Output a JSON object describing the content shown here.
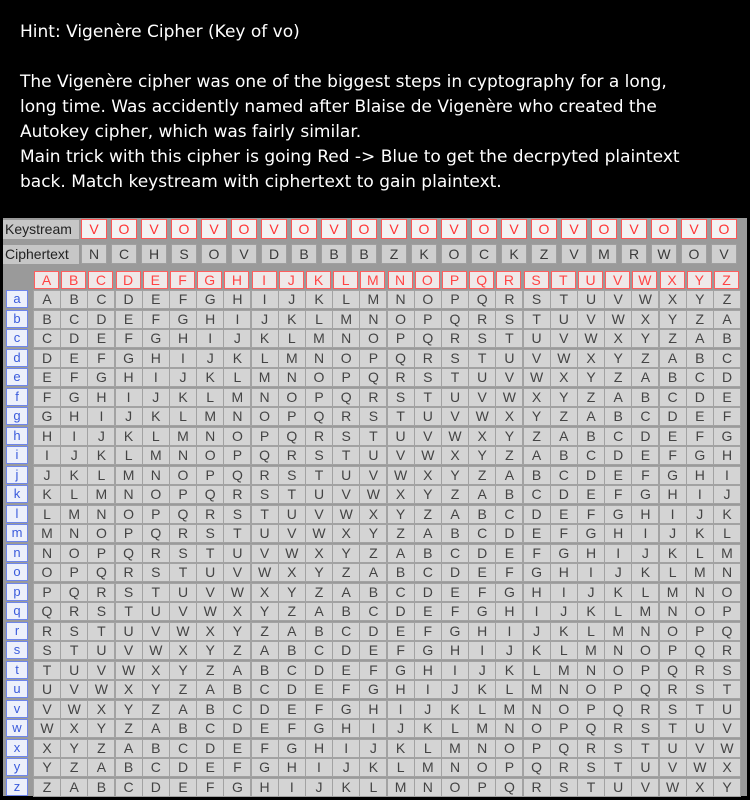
{
  "hint": {
    "title": "Hint: Vigenère Cipher (Key of vo)",
    "body_lines": [
      "The Vigenère cipher was one of the biggest steps in cyptography for a long,",
      "long time. Was accidently named after Blaise de Vigenère who created the",
      "Autokey cipher, which was fairly similar.",
      "Main trick with this cipher is going Red -> Blue to get the decrpyted plaintext",
      "back. Match keystream with ciphertext to gain plaintext."
    ]
  },
  "keystream": {
    "label": "Keystream",
    "letters": [
      "V",
      "O",
      "V",
      "O",
      "V",
      "O",
      "V",
      "O",
      "V",
      "O",
      "V",
      "O",
      "V",
      "O",
      "V",
      "O",
      "V",
      "O",
      "V",
      "O",
      "V",
      "O"
    ]
  },
  "ciphertext": {
    "label": "Ciphertext",
    "letters": [
      "N",
      "C",
      "H",
      "S",
      "O",
      "V",
      "D",
      "B",
      "B",
      "B",
      "Z",
      "K",
      "O",
      "C",
      "K",
      "Z",
      "V",
      "M",
      "R",
      "W",
      "O",
      "V"
    ]
  },
  "tabula": {
    "header_letters": [
      "A",
      "B",
      "C",
      "D",
      "E",
      "F",
      "G",
      "H",
      "I",
      "J",
      "K",
      "L",
      "M",
      "N",
      "O",
      "P",
      "Q",
      "R",
      "S",
      "T",
      "U",
      "V",
      "W",
      "X",
      "Y",
      "Z"
    ],
    "row_labels": [
      "a",
      "b",
      "c",
      "d",
      "e",
      "f",
      "g",
      "h",
      "i",
      "j",
      "k",
      "l",
      "m",
      "n",
      "o",
      "p",
      "q",
      "r",
      "s",
      "t",
      "u",
      "v",
      "w",
      "x",
      "y",
      "z"
    ],
    "rows": [
      "ABCDEFGHIJKLMNOPQRSTUVWXYZ",
      "BCDEFGHIJKLMNOPQRSTUVWXYZA",
      "CDEFGHIJKLMNOPQRSTUVWXYZAB",
      "DEFGHIJKLMNOPQRSTUVWXYZABC",
      "EFGHIJKLMNOPQRSTUVWXYZABCD",
      "FGHIJKLMNOPQRSTUVWXYZABCDE",
      "GHIJKLMNOPQRSTUVWXYZABCDEF",
      "HIJKLMNOPQRSTUVWXYZABCDEFG",
      "IJKLMNOPQRSTUVWXYZABCDEFGH",
      "JKLMNOPQRSTUVWXYZABCDEFGHI",
      "KLMNOPQRSTUVWXYZABCDEFGHIJ",
      "LMNOPQRSTUVWXYZABCDEFGHIJK",
      "MNOPQRSTUVWXYZABCDEFGHIJKL",
      "NOPQRSTUVWXYZABCDEFGHIJKLM",
      "OPQRSTUVWXYZABCDEFGHIJKLMN",
      "PQRSTUVWXYZABCDEFGHIJKLMNO",
      "QRSTUVWXYZABCDEFGHIJKLMNOP",
      "RSTUVWXYZABCDEFGHIJKLMNOPQ",
      "STUVWXYZABCDEFGHIJKLMNOPQR",
      "TUVWXYZABCDEFGHIJKLMNOPQRS",
      "UVWXYZABCDEFGHIJKLMNOPQRST",
      "VWXYZABCDEFGHIJKLMNOPQRSTU",
      "WXYZABCDEFGHIJKLMNOPQRSTUV",
      "XYZABCDEFGHIJKLMNOPQRSTUVW",
      "YZABCDEFGHIJKLMNOPQRSTUVWX",
      "ZABCDEFGHIJKLMNOPQRSTUVWXY"
    ]
  },
  "colors": {
    "key_red": "#ff3333",
    "row_blue": "#3a5bdc",
    "background": "#000000"
  }
}
